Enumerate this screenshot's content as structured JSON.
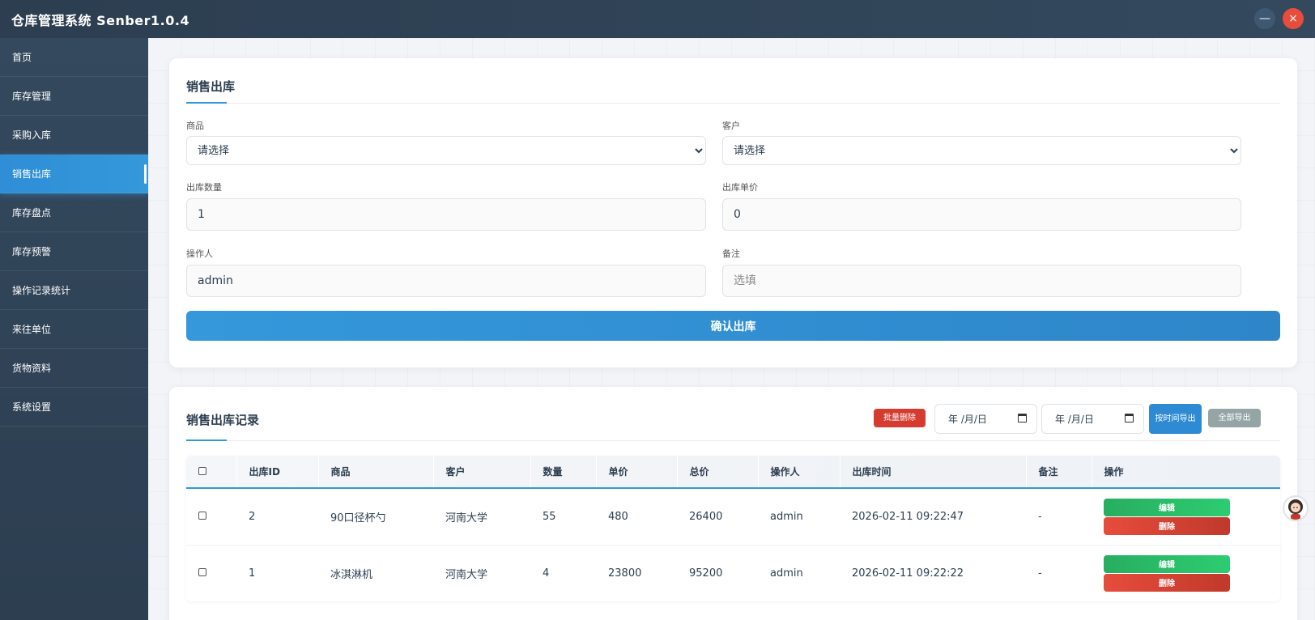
{
  "app": {
    "title": "仓库管理系统 Senber1.0.4",
    "minimize_symbol": "—",
    "close_symbol": "×"
  },
  "sidebar": {
    "items": [
      {
        "label": "首页",
        "active": false
      },
      {
        "label": "库存管理",
        "active": false
      },
      {
        "label": "采购入库",
        "active": false
      },
      {
        "label": "销售出库",
        "active": true
      },
      {
        "label": "库存盘点",
        "active": false
      },
      {
        "label": "库存预警",
        "active": false
      },
      {
        "label": "操作记录统计",
        "active": false
      },
      {
        "label": "来往单位",
        "active": false
      },
      {
        "label": "货物资料",
        "active": false
      },
      {
        "label": "系统设置",
        "active": false
      }
    ]
  },
  "form": {
    "title": "销售出库",
    "product_label": "商品",
    "product_value": "请选择",
    "customer_label": "客户",
    "customer_value": "请选择",
    "quantity_label": "出库数量",
    "quantity_value": "1",
    "unit_price_label": "出库单价",
    "unit_price_value": "0",
    "operator_label": "操作人",
    "operator_value": "admin",
    "remark_label": "备注",
    "remark_placeholder": "选填",
    "submit_label": "确认出库"
  },
  "records": {
    "title": "销售出库记录",
    "batch_delete_label": "批量删除",
    "date_start_placeholder": "年 /月/日",
    "date_end_placeholder": "年 /月/日",
    "export_by_time_label": "按时间导出",
    "export_all_label": "全部导出",
    "columns": [
      "出库ID",
      "商品",
      "客户",
      "数量",
      "单价",
      "总价",
      "操作人",
      "出库时间",
      "备注",
      "操作"
    ],
    "rows": [
      {
        "id": "2",
        "product": "90口径杯勺",
        "customer": "河南大学",
        "quantity": "55",
        "unit_price": "480",
        "total": "26400",
        "operator": "admin",
        "time": "2026-02-11 09:22:47",
        "remark": "-"
      },
      {
        "id": "1",
        "product": "冰淇淋机",
        "customer": "河南大学",
        "quantity": "4",
        "unit_price": "23800",
        "total": "95200",
        "operator": "admin",
        "time": "2026-02-11 09:22:22",
        "remark": "-"
      }
    ],
    "edit_label": "编辑",
    "delete_label": "删除"
  },
  "colors": {
    "accent": "#3498db",
    "sidebar_bg": "#2c3e50",
    "danger": "#e74c3c",
    "success": "#27ae60",
    "muted": "#95a5a6"
  }
}
